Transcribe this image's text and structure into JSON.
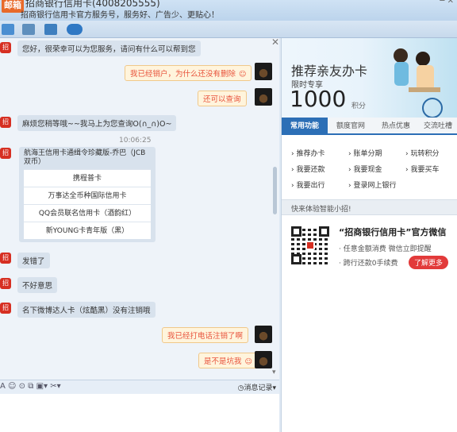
{
  "window": {
    "logo_text": "邮箱",
    "title": "招商银行信用卡(4008205555)",
    "subtitle": "招商银行信用卡官方服务号，服务好、广告少、更贴心！",
    "controls": "─ ✕"
  },
  "chat": {
    "messages": [
      {
        "side": "left",
        "text": "您好，很荣幸可以为您服务，请问有什么可以帮到您"
      },
      {
        "side": "right",
        "text": "我已经销户，为什么还没有删除"
      },
      {
        "side": "right",
        "text": "还可以查询"
      },
      {
        "side": "left",
        "text": "麻烦您稍等哦~~我马上为您查询O(∩_∩)O~"
      },
      {
        "side": "left",
        "text": "发错了"
      },
      {
        "side": "left",
        "text": "不好意思"
      },
      {
        "side": "left",
        "text": "名下微博达人卡（炫酷黑）没有注销哦"
      },
      {
        "side": "right",
        "text": "我已经打电话注销了啊"
      },
      {
        "side": "right",
        "text": "是不是坑我"
      }
    ],
    "timestamp": "10:06:25",
    "card": {
      "header": "航海王信用卡通缉令珍藏版-乔巴（JCB双币）",
      "rows": [
        "携程普卡",
        "万事达全币种国际信用卡",
        "QQ会员联名信用卡（酒韵红）",
        "新YOUNG卡青年版（黑）"
      ]
    }
  },
  "input": {
    "history_label": "消息记录"
  },
  "side": {
    "banner": {
      "title": "推荐亲友办卡",
      "sub": "限时专享",
      "points_value": "1000",
      "points_unit": "积分"
    },
    "tabs": [
      "常用功能",
      "额度官网",
      "热点优惠",
      "交流吐槽"
    ],
    "links": [
      "推荐办卡",
      "账单分期",
      "玩转积分",
      "我要还款",
      "我要现金",
      "我要买车",
      "我要出行",
      "登录网上银行"
    ],
    "cta": "快来体验智能小招!",
    "wechat": {
      "title": "“招商银行信用卡”官方微信",
      "line1": "· 任意金额消费 微信立即提醒",
      "line2": "· 跨行还款0手续费",
      "button": "了解更多"
    }
  },
  "colors": {
    "accent": "#2c6fb6",
    "brand_red": "#d62f22",
    "bubble_right_text": "#e8523b"
  }
}
